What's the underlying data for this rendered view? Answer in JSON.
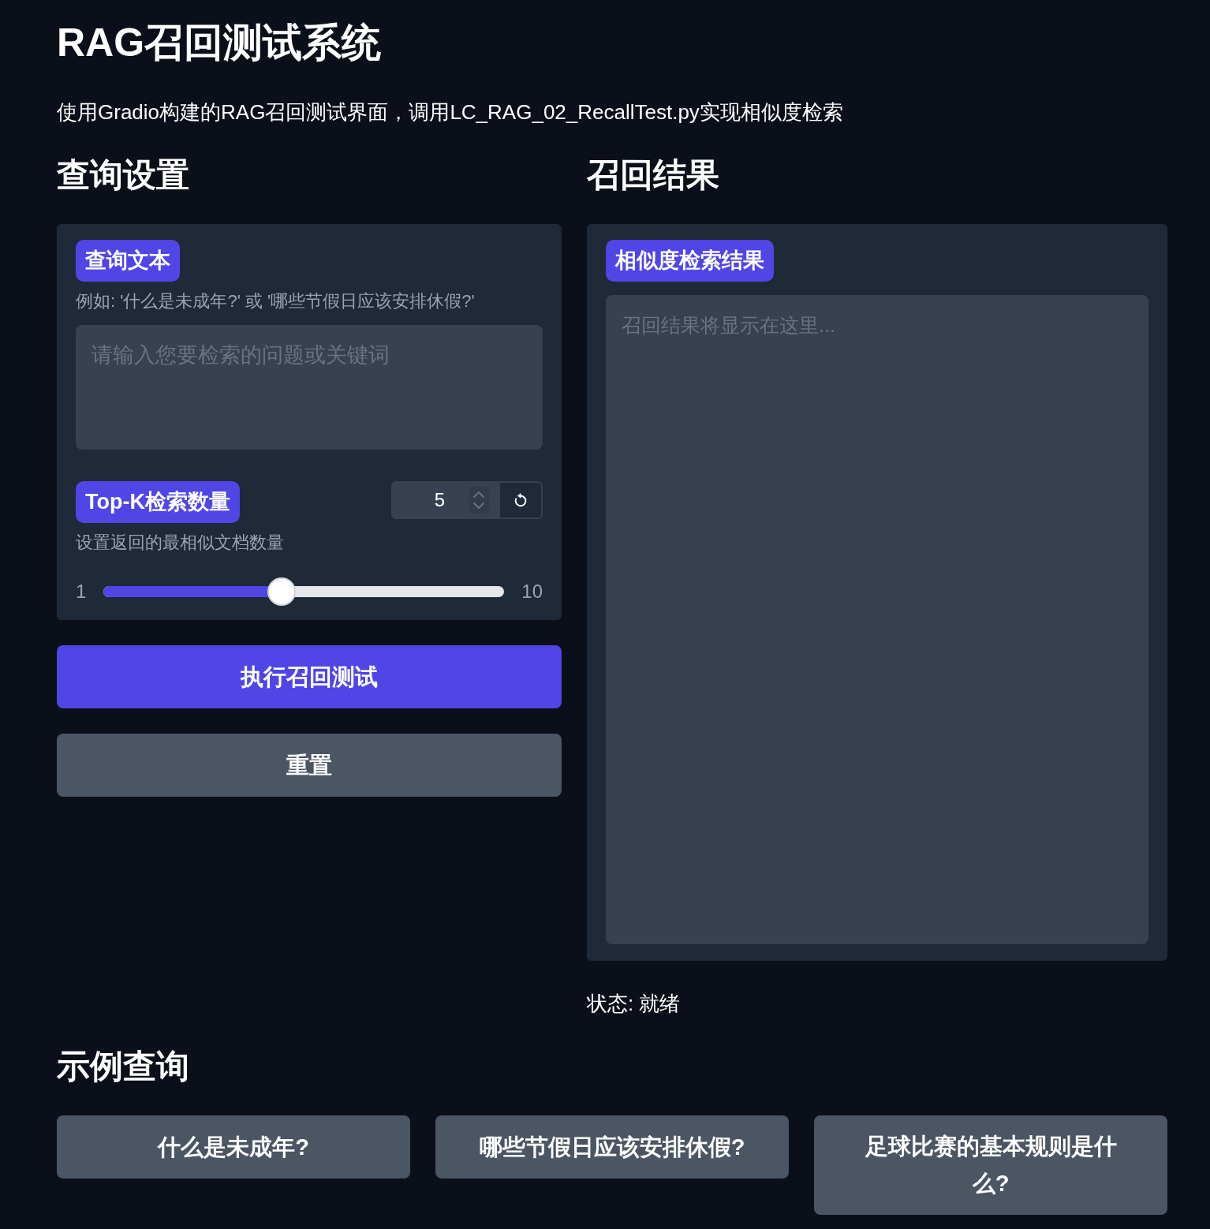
{
  "header": {
    "title": "RAG召回测试系统",
    "subtitle": "使用Gradio构建的RAG召回测试界面，调用LC_RAG_02_RecallTest.py实现相似度检索"
  },
  "query_settings": {
    "heading": "查询设置",
    "query_text": {
      "label": "查询文本",
      "info": "例如: '什么是未成年?' 或 '哪些节假日应该安排休假?'",
      "placeholder": "请输入您要检索的问题或关键词"
    },
    "top_k": {
      "label": "Top-K检索数量",
      "value": "5",
      "info": "设置返回的最相似文档数量",
      "min_label": "1",
      "max_label": "10",
      "level": 0.444
    },
    "buttons": [
      {
        "label": "执行召回测试",
        "kind": "primary"
      },
      {
        "label": "重置",
        "kind": "secondary"
      }
    ]
  },
  "recall_results": {
    "heading": "召回结果",
    "results": {
      "label": "相似度检索结果",
      "placeholder": "召回结果将显示在这里..."
    },
    "status": "状态: 就绪"
  },
  "examples": {
    "heading": "示例查询",
    "items": [
      "什么是未成年?",
      "哪些节假日应该安排休假?",
      "足球比赛的基本规则是什么?"
    ]
  }
}
